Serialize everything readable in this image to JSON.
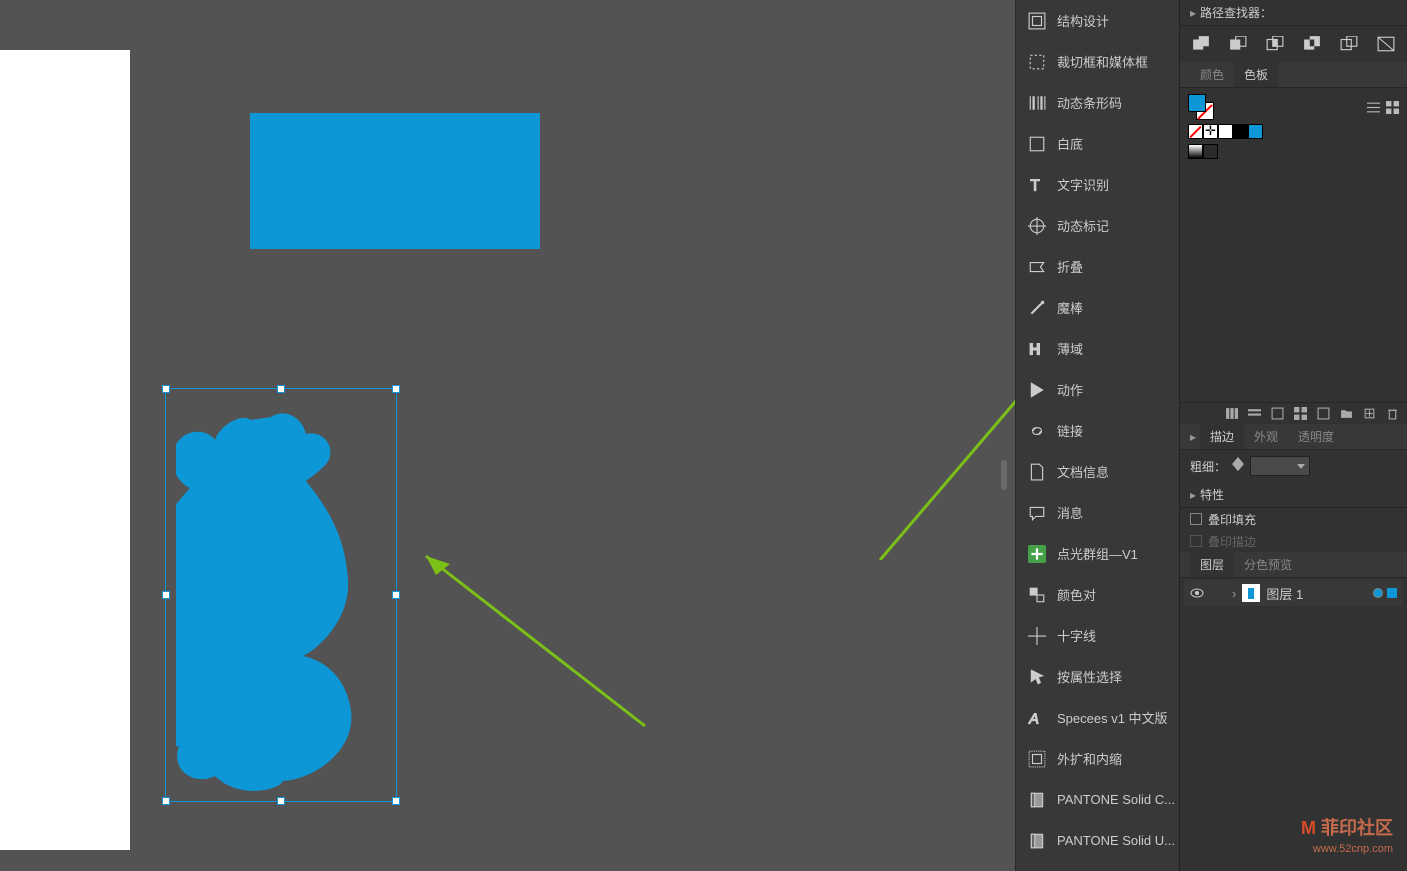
{
  "pathfinder": {
    "title": "路径查找器："
  },
  "panels": {
    "items": [
      "结构设计",
      "裁切框和媒体框",
      "动态条形码",
      "白底",
      "文字识别",
      "动态标记",
      "折叠",
      "魔棒",
      "薄域",
      "动作",
      "链接",
      "文档信息",
      "消息",
      "点光群组—V1",
      "颜色对",
      "十字线",
      "按属性选择",
      "Specees v1 中文版",
      "外扩和内缩",
      "PANTONE Solid C...",
      "PANTONE Solid U..."
    ]
  },
  "colorTabs": {
    "inactive": "颜色",
    "active": "色板"
  },
  "strokeTabs": {
    "active": "描边",
    "t2": "外观",
    "t3": "透明度"
  },
  "stroke": {
    "label": "粗细："
  },
  "props": {
    "header": "特性",
    "overprintFill": "叠印填充",
    "overprintStroke": "叠印描边"
  },
  "layerTabs": {
    "active": "图层",
    "t2": "分色预览"
  },
  "layers": {
    "name": "图层 1"
  },
  "watermark": {
    "brand": "菲印社区",
    "url": "www.52cnp.com"
  }
}
